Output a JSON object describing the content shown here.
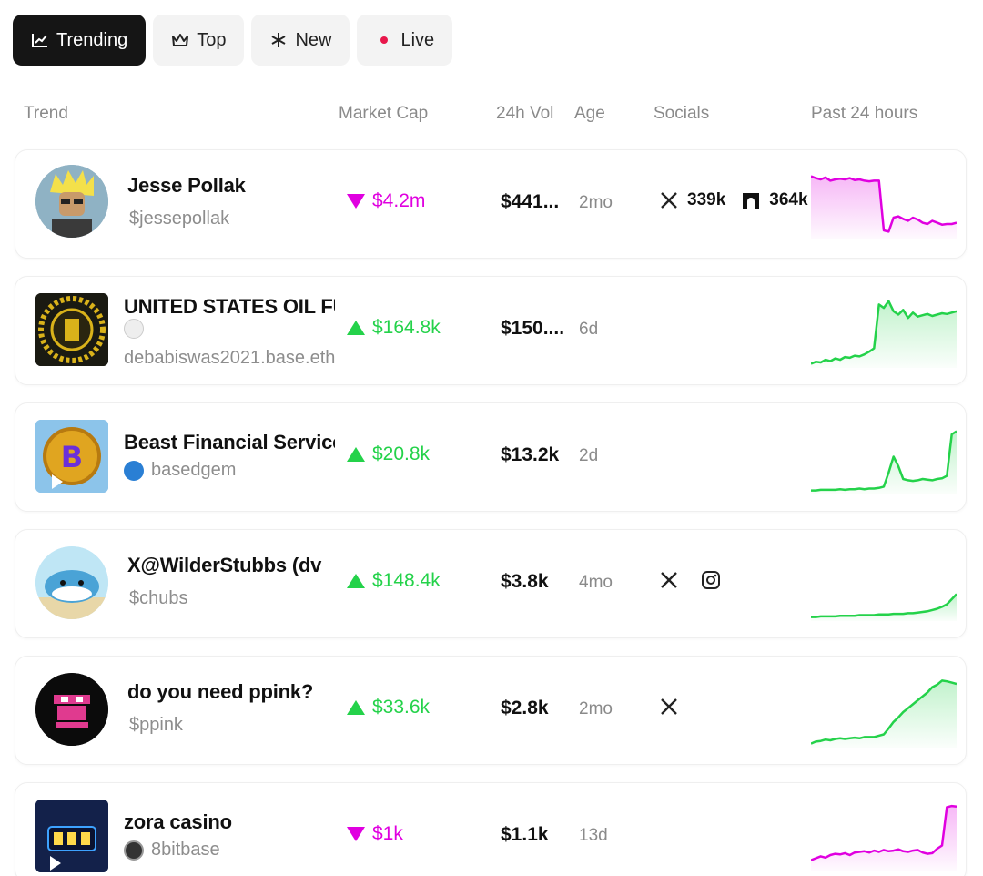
{
  "tabs": [
    {
      "label": "Trending",
      "icon": "chart-line-icon",
      "active": true
    },
    {
      "label": "Top",
      "icon": "crown-icon",
      "active": false
    },
    {
      "label": "New",
      "icon": "sparkle-icon",
      "active": false
    },
    {
      "label": "Live",
      "icon": "live-dot-icon",
      "active": false
    }
  ],
  "columns": {
    "trend": "Trend",
    "market_cap": "Market Cap",
    "vol": "24h Vol",
    "age": "Age",
    "socials": "Socials",
    "past24": "Past 24 hours"
  },
  "colors": {
    "up": "#24d24a",
    "down": "#e000e0",
    "live": "#e8174b"
  },
  "rows": [
    {
      "name": "Jesse Pollak",
      "sub": "$jessepollak",
      "market_cap": "$4.2m",
      "direction": "down",
      "vol": "$441...",
      "age": "2mo",
      "socials": [
        {
          "icon": "x-icon",
          "count": "339k"
        },
        {
          "icon": "farcaster-icon",
          "count": "364k"
        }
      ],
      "spark": [
        0.95,
        0.92,
        0.9,
        0.93,
        0.88,
        0.9,
        0.91,
        0.9,
        0.92,
        0.89,
        0.9,
        0.88,
        0.87,
        0.88,
        0.88,
        0.1,
        0.08,
        0.3,
        0.32,
        0.28,
        0.25,
        0.3,
        0.27,
        0.22,
        0.2,
        0.25,
        0.22,
        0.19,
        0.2,
        0.2,
        0.22
      ]
    },
    {
      "name": "UNITED STATES OIL FUND",
      "owner_line": "",
      "sub": "debabiswas2021.base.eth",
      "market_cap": "$164.8k",
      "direction": "up",
      "vol": "$150....",
      "age": "6d",
      "socials": [],
      "spark": [
        0.02,
        0.05,
        0.04,
        0.08,
        0.06,
        0.1,
        0.08,
        0.12,
        0.11,
        0.14,
        0.13,
        0.16,
        0.2,
        0.25,
        0.9,
        0.85,
        0.95,
        0.8,
        0.75,
        0.82,
        0.7,
        0.78,
        0.72,
        0.74,
        0.76,
        0.73,
        0.75,
        0.77,
        0.76,
        0.78,
        0.8
      ]
    },
    {
      "name": "Beast Financial Services",
      "sub": "basedgem",
      "market_cap": "$20.8k",
      "direction": "up",
      "vol": "$13.2k",
      "age": "2d",
      "socials": [],
      "spark": [
        0.02,
        0.02,
        0.03,
        0.03,
        0.03,
        0.03,
        0.04,
        0.03,
        0.04,
        0.04,
        0.05,
        0.04,
        0.05,
        0.05,
        0.06,
        0.08,
        0.3,
        0.55,
        0.4,
        0.2,
        0.18,
        0.17,
        0.18,
        0.2,
        0.19,
        0.18,
        0.2,
        0.21,
        0.25,
        0.9,
        0.95
      ]
    },
    {
      "name": "X@WilderStubbs (dv",
      "sub": "$chubs",
      "market_cap": "$148.4k",
      "direction": "up",
      "vol": "$3.8k",
      "age": "4mo",
      "socials": [
        {
          "icon": "x-icon",
          "count": ""
        },
        {
          "icon": "instagram-icon",
          "count": ""
        }
      ],
      "spark": [
        0.02,
        0.02,
        0.03,
        0.03,
        0.03,
        0.03,
        0.04,
        0.04,
        0.04,
        0.04,
        0.05,
        0.05,
        0.05,
        0.05,
        0.06,
        0.06,
        0.06,
        0.07,
        0.07,
        0.07,
        0.08,
        0.08,
        0.09,
        0.1,
        0.11,
        0.13,
        0.15,
        0.18,
        0.22,
        0.3,
        0.38
      ]
    },
    {
      "name": "do you need ppink?",
      "sub": "$ppink",
      "market_cap": "$33.6k",
      "direction": "up",
      "vol": "$2.8k",
      "age": "2mo",
      "socials": [
        {
          "icon": "x-icon",
          "count": ""
        }
      ],
      "spark": [
        0.02,
        0.05,
        0.06,
        0.08,
        0.07,
        0.09,
        0.1,
        0.09,
        0.1,
        0.11,
        0.1,
        0.12,
        0.12,
        0.12,
        0.14,
        0.16,
        0.25,
        0.35,
        0.42,
        0.5,
        0.56,
        0.62,
        0.68,
        0.74,
        0.8,
        0.88,
        0.92,
        0.98,
        0.97,
        0.95,
        0.93
      ]
    },
    {
      "name": "zora casino",
      "sub": "8bitbase",
      "market_cap": "$1k",
      "direction": "down",
      "vol": "$1.1k",
      "age": "13d",
      "socials": [],
      "spark": [
        0.12,
        0.15,
        0.18,
        0.16,
        0.2,
        0.22,
        0.21,
        0.23,
        0.2,
        0.24,
        0.25,
        0.26,
        0.24,
        0.27,
        0.25,
        0.28,
        0.26,
        0.27,
        0.29,
        0.26,
        0.25,
        0.27,
        0.28,
        0.24,
        0.22,
        0.23,
        0.3,
        0.35,
        0.95,
        0.97,
        0.96
      ]
    }
  ]
}
